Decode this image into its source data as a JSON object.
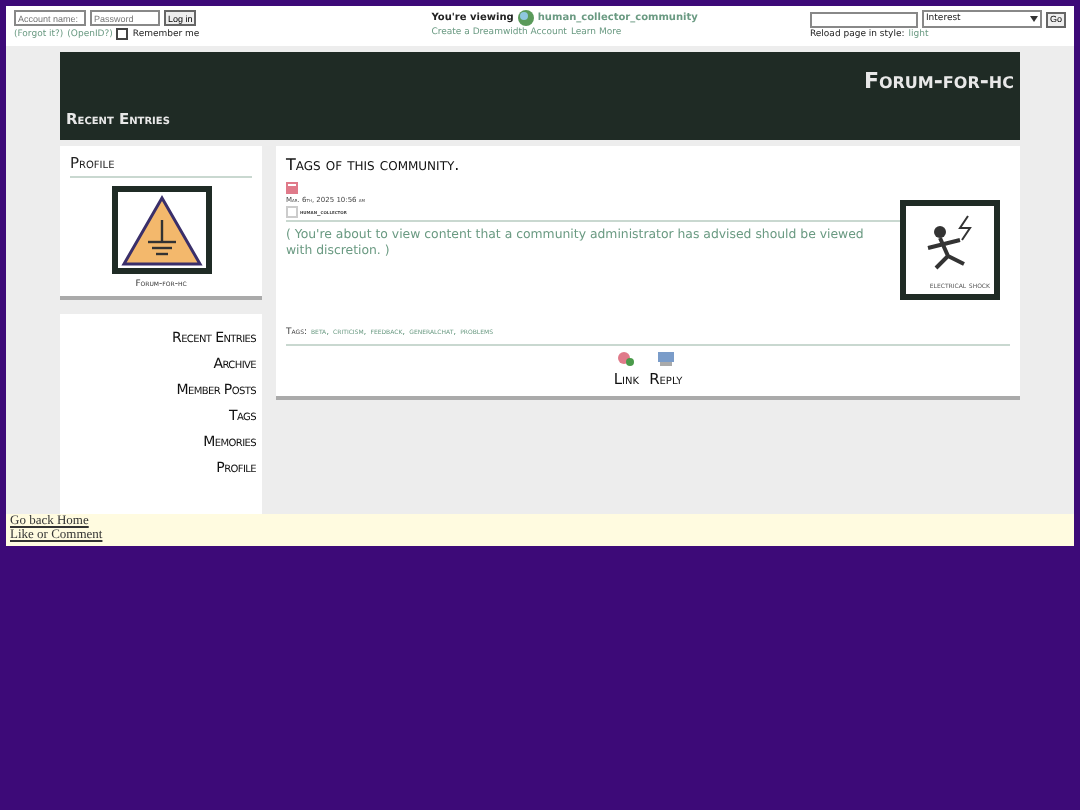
{
  "login": {
    "account_placeholder": "Account name:",
    "password_placeholder": "Password",
    "button": "Log in",
    "forgot": "(Forgot it?)",
    "openid": "(OpenID?)",
    "remember": {
      "label": "Remember me",
      "checked": false
    }
  },
  "viewing": {
    "prefix": "You're viewing",
    "community": "human_collector_community",
    "create": "Create a Dreamwidth Account",
    "learn": "Learn More"
  },
  "search": {
    "select": "Interest",
    "go": "Go",
    "reload": "Reload page in style:",
    "style": "light"
  },
  "header": {
    "title": "Forum-for-hc",
    "subtitle": "Recent Entries"
  },
  "profile": {
    "heading": "Profile",
    "name": "Forum-for-hc"
  },
  "nav": [
    "Recent Entries",
    "Archive",
    "Member Posts",
    "Tags",
    "Memories",
    "Profile"
  ],
  "entry": {
    "title": "Tags of this community.",
    "date": "Mar. 6th, 2025 10:56 am",
    "user": "human_collector",
    "warning": "( You're about to view content that a community administrator has advised should be viewed with discretion. )",
    "icon_caption": "electrical shock",
    "tags_label": "Tags:",
    "tags": [
      "beta,",
      "criticism,",
      "feedback,",
      "generalchat,",
      "problems"
    ],
    "actions": [
      "Link",
      "Reply"
    ]
  },
  "footer": [
    "Go back Home",
    "Like or Comment"
  ]
}
